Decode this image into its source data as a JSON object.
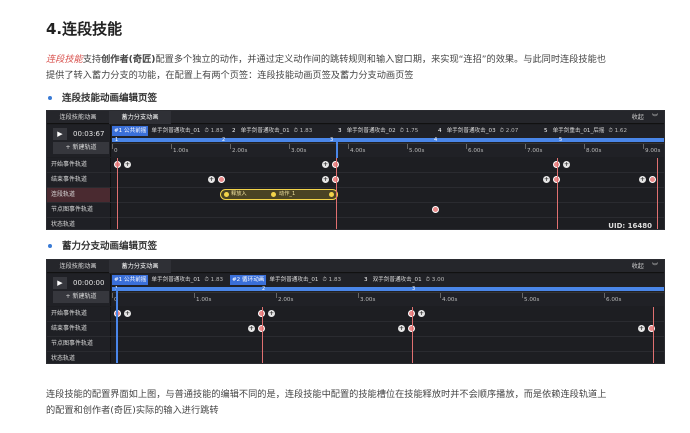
{
  "heading": "4.连段技能",
  "intro": {
    "hl": "连段技能",
    "t1": "支持",
    "b1": "创作者(奇匠)",
    "t2": "配置多个独立的动作，并通过定义动作间的跳转规则和输入窗口期，来实现“连招”的效果。与此同时连段技能也",
    "line2": "提供了转入蓄力分支的功能，在配置上有两个页签：连段技能动画页签及蓄力分支动画页签"
  },
  "bullet1": "连段技能动画编辑页签",
  "bullet2": "蓄力分支动画编辑页签",
  "outro": {
    "line1": "连段技能的配置界面如上图，与普通技能的编辑不同的是，连段技能中配置的技能槽位在技能释放时并不会顺序播放，而是依赖连段轨道上",
    "line2": "的配置和创作者(奇匠)实际的输入进行跳转"
  },
  "editor1": {
    "tabs": [
      "连段技能动画",
      "蓄力分支动画"
    ],
    "collapse": "收起",
    "collapse_icon": "chevron-double-down-icon",
    "play_icon": "play-icon",
    "time": "00:03:67",
    "new_track": "+ 新建轨道",
    "segments": [
      {
        "num": "#1 公共前摇",
        "name": "单手剑普通攻击_01",
        "dur": "1.83"
      },
      {
        "num": "2",
        "name": "单手剑普通攻击_01",
        "dur": "1.83"
      },
      {
        "num": "3",
        "name": "单手剑普通攻击_02",
        "dur": "1.75"
      },
      {
        "num": "4",
        "name": "单手剑普通攻击_03",
        "dur": "2.07"
      },
      {
        "num": "5",
        "name": "单手剑重击_01_后摇",
        "dur": "1.62"
      }
    ],
    "bar_markers": [
      "1",
      "2",
      "3",
      "4",
      "5"
    ],
    "ticks": [
      "0",
      "1.00s",
      "2.00s",
      "3.00s",
      "4.00s",
      "5.00s",
      "6.00s",
      "7.00s",
      "8.00s",
      "9.00s"
    ],
    "tracks": [
      "开始事件轨道",
      "结束事件轨道",
      "连段轨道",
      "节点图事件轨道",
      "状态轨道"
    ],
    "clip_labels": [
      "释放入",
      "动作_1"
    ],
    "uid": "UID: 16480"
  },
  "editor2": {
    "tabs": [
      "连段技能动画",
      "蓄力分支动画"
    ],
    "collapse": "收起",
    "collapse_icon": "chevron-double-down-icon",
    "play_icon": "play-icon",
    "time": "00:00:00",
    "new_track": "+ 新建轨道",
    "segments": [
      {
        "num": "#1 公共前摇",
        "name": "单手剑普通攻击_01",
        "dur": "1.83"
      },
      {
        "num": "#2 循环动画",
        "name": "单手剑普通攻击_01",
        "dur": "1.83"
      },
      {
        "num": "3",
        "name": "双手剑普通攻击_01",
        "dur": "3.00"
      }
    ],
    "bar_markers": [
      "1",
      "2",
      "3"
    ],
    "ticks": [
      "0",
      "1.00s",
      "2.00s",
      "3.00s",
      "4.00s",
      "5.00s",
      "6.00s"
    ],
    "tracks": [
      "开始事件轨道",
      "结束事件轨道",
      "节点图事件轨道",
      "状态轨道"
    ]
  }
}
